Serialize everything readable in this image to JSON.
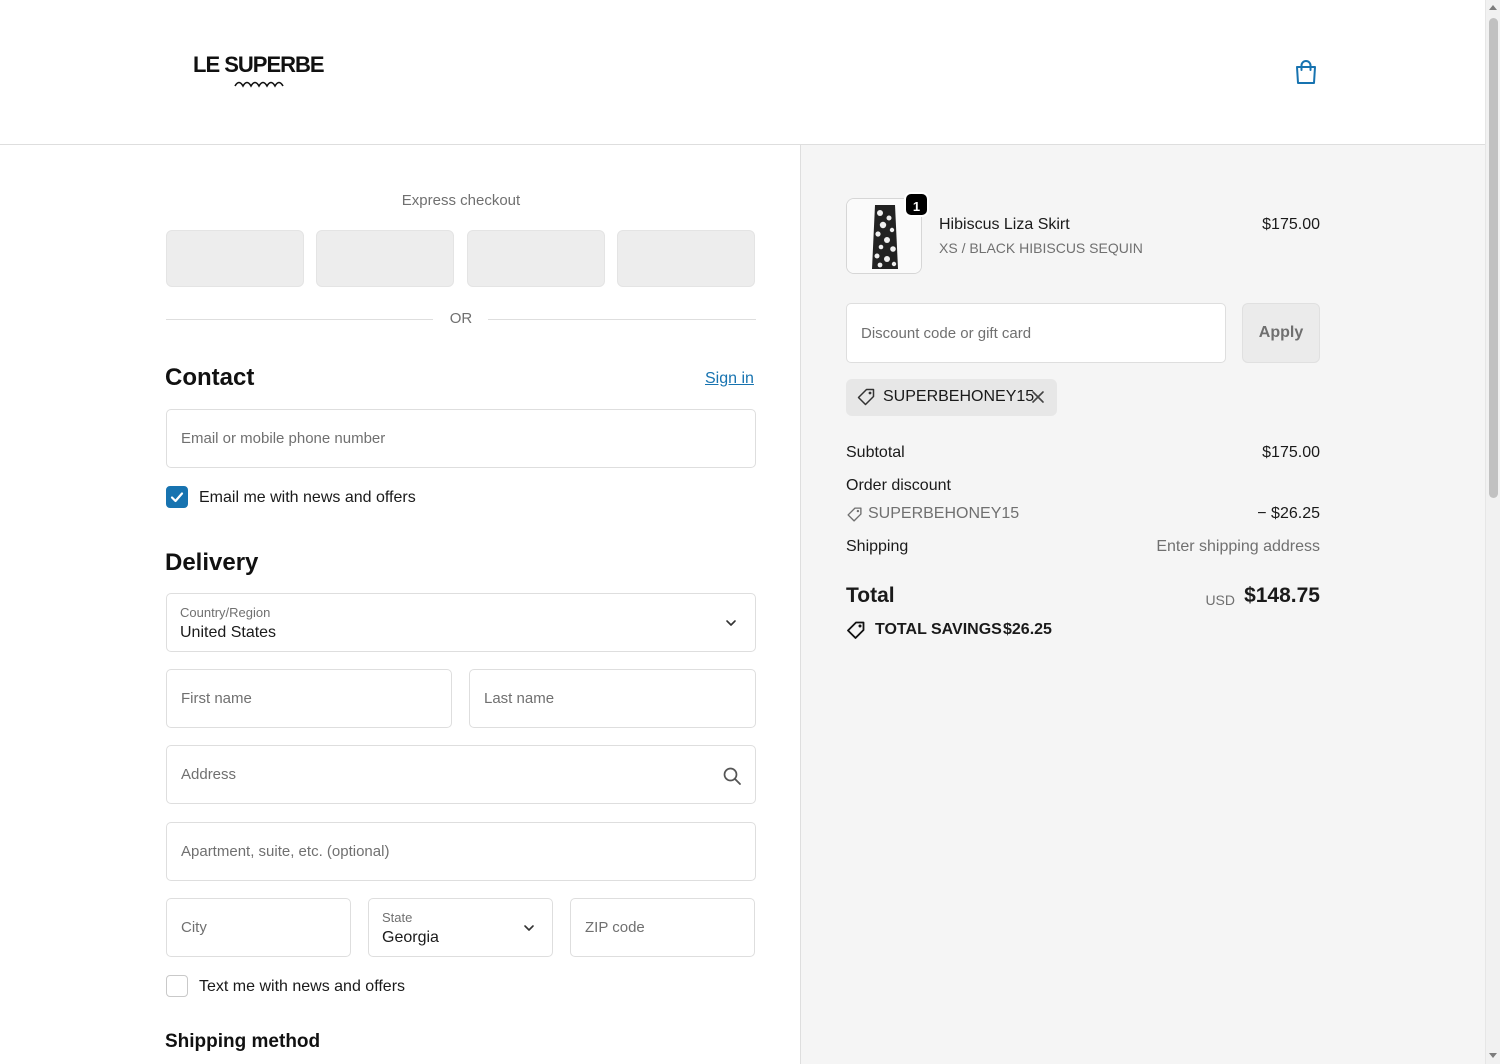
{
  "header": {
    "logo_text": "LE SUPERBE",
    "cart_icon": "shopping-bag-icon",
    "accent_color": "#1773b0"
  },
  "express": {
    "title": "Express checkout",
    "divider_text": "OR"
  },
  "contact": {
    "title": "Contact",
    "sign_in": "Sign in",
    "email_placeholder": "Email or mobile phone number",
    "email_news_label": "Email me with news and offers",
    "email_news_checked": true
  },
  "delivery": {
    "title": "Delivery",
    "country_label": "Country/Region",
    "country_value": "United States",
    "first_name_placeholder": "First name",
    "last_name_placeholder": "Last name",
    "address_placeholder": "Address",
    "apartment_placeholder": "Apartment, suite, etc. (optional)",
    "city_placeholder": "City",
    "state_label": "State",
    "state_value": "Georgia",
    "zip_placeholder": "ZIP code",
    "text_news_label": "Text me with news and offers",
    "text_news_checked": false
  },
  "shipping_method": {
    "title": "Shipping method"
  },
  "summary": {
    "item": {
      "quantity": "1",
      "name": "Hibiscus Liza Skirt",
      "variant": "XS / BLACK HIBISCUS SEQUIN",
      "price": "$175.00"
    },
    "discount_placeholder": "Discount code or gift card",
    "apply_label": "Apply",
    "applied_code": "SUPERBEHONEY15",
    "subtotal_label": "Subtotal",
    "subtotal_value": "$175.00",
    "order_discount_label": "Order discount",
    "discount_code": "SUPERBEHONEY15",
    "discount_value": "− $26.25",
    "shipping_label": "Shipping",
    "shipping_value": "Enter shipping address",
    "total_label": "Total",
    "currency": "USD",
    "total_value": "$148.75",
    "savings_label": "TOTAL SAVINGS",
    "savings_value": "$26.25"
  }
}
